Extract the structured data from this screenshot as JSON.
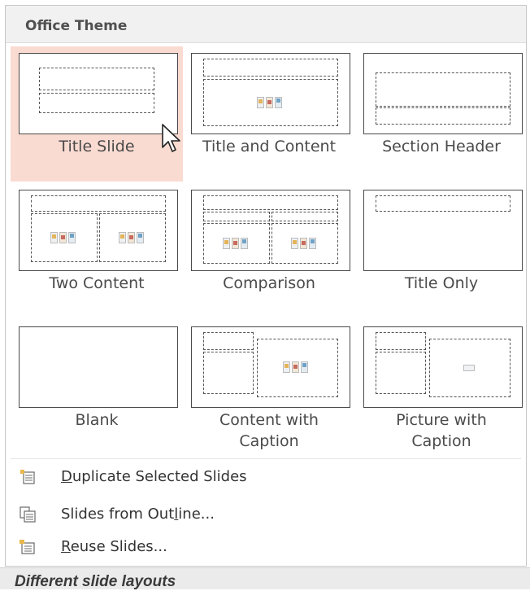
{
  "section_header": "Office Theme",
  "layouts": [
    {
      "label": "Title Slide",
      "selected": true
    },
    {
      "label": "Title and Content"
    },
    {
      "label": "Section Header"
    },
    {
      "label": "Two Content"
    },
    {
      "label": "Comparison"
    },
    {
      "label": "Title Only"
    },
    {
      "label": "Blank"
    },
    {
      "label_line1": "Content with",
      "label_line2": "Caption"
    },
    {
      "label_line1": "Picture with",
      "label_line2": "Caption"
    }
  ],
  "menu": [
    {
      "pre": "",
      "ul": "D",
      "post": "uplicate Selected Slides",
      "icon": "duplicate-slides-icon"
    },
    {
      "pre": "Slides from Out",
      "ul": "l",
      "post": "ine...",
      "icon": "outline-slides-icon"
    },
    {
      "pre": "",
      "ul": "R",
      "post": "euse Slides...",
      "icon": "reuse-slides-icon"
    }
  ],
  "caption": "Different slide layouts",
  "colors": {
    "hover_bg": "#fadbd2",
    "header_bg": "#f1f1f1"
  }
}
